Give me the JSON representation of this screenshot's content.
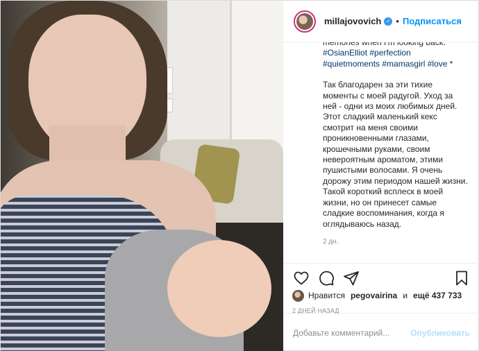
{
  "header": {
    "username": "millajovovich",
    "verified_icon": "verified-check-icon",
    "separator": "•",
    "follow_label": "Подписаться"
  },
  "caption": {
    "cut_line": "memories when I'm looking back.",
    "tags_line": "#OsianElliot #perfection #quietmoments #mamasgirl #love *",
    "russian": "Так благодарен за эти тихие моменты с моей радугой. Уход за ней - одни из моих любимых дней. Этот сладкий маленький кекс смотрит на меня своими проникновенными глазами, крошечными руками, своим невероятным ароматом, этими пушистыми волосами. Я очень дорожу этим периодом нашей жизни. Такой короткий всплеск в моей жизни, но он принесет самые сладкие воспоминания, когда я оглядываюсь назад.",
    "time": "2 дн."
  },
  "actions": {
    "icons": [
      "heart-icon",
      "comment-icon",
      "share-icon",
      "bookmark-icon"
    ]
  },
  "likes": {
    "prefix": "Нравится",
    "user": "pegovairina",
    "joiner": "и",
    "others": "ещё 437 733"
  },
  "date": "2 ДНЕЙ НАЗАД",
  "comment": {
    "placeholder": "Добавьте комментарий...",
    "publish_label": "Опубликовать"
  }
}
